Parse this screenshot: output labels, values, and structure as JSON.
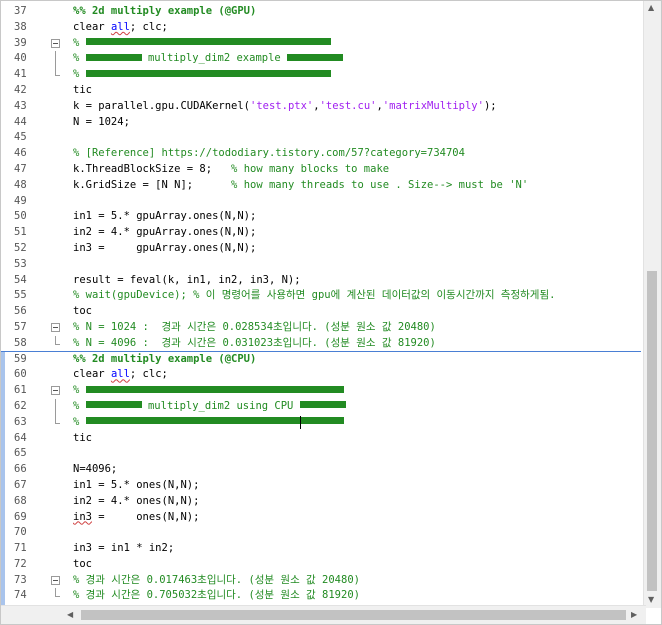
{
  "editor": {
    "lines": [
      {
        "n": "37",
        "parts": [
          {
            "t": "%% 2d multiply example (@GPU)",
            "c": "bold"
          }
        ]
      },
      {
        "n": "38",
        "parts": [
          {
            "t": "clear ",
            "c": ""
          },
          {
            "t": "all",
            "c": "kw squig"
          },
          {
            "t": "; clc;",
            "c": ""
          }
        ]
      },
      {
        "n": "39",
        "fold": "box",
        "parts": [
          {
            "t": "% ",
            "c": "cmt"
          },
          {
            "bar": 245
          }
        ]
      },
      {
        "n": "40",
        "fold": "vline",
        "parts": [
          {
            "t": "% ",
            "c": "cmt"
          },
          {
            "bar": 56
          },
          {
            "t": " multiply_dim2 example ",
            "c": "cmt"
          },
          {
            "bar": 56
          }
        ]
      },
      {
        "n": "41",
        "fold": "end",
        "parts": [
          {
            "t": "% ",
            "c": "cmt"
          },
          {
            "bar": 245
          }
        ]
      },
      {
        "n": "42",
        "parts": [
          {
            "t": "tic",
            "c": ""
          }
        ]
      },
      {
        "n": "43",
        "parts": [
          {
            "t": "k = parallel.gpu.CUDAKernel(",
            "c": ""
          },
          {
            "t": "'test.ptx'",
            "c": "str"
          },
          {
            "t": ",",
            "c": ""
          },
          {
            "t": "'test.cu'",
            "c": "str"
          },
          {
            "t": ",",
            "c": ""
          },
          {
            "t": "'matrixMultiply'",
            "c": "str"
          },
          {
            "t": ");",
            "c": ""
          }
        ]
      },
      {
        "n": "44",
        "parts": [
          {
            "t": "N = 1024;",
            "c": ""
          }
        ]
      },
      {
        "n": "45",
        "parts": []
      },
      {
        "n": "46",
        "parts": [
          {
            "t": "% [Reference] https://tododiary.tistory.com/57?category=734704",
            "c": "cmt"
          }
        ]
      },
      {
        "n": "47",
        "parts": [
          {
            "t": "k.ThreadBlockSize = 8;   ",
            "c": ""
          },
          {
            "t": "% how many blocks to make",
            "c": "cmt"
          }
        ]
      },
      {
        "n": "48",
        "parts": [
          {
            "t": "k.GridSize = [N N];      ",
            "c": ""
          },
          {
            "t": "% how many threads to use . Size--> must be 'N'",
            "c": "cmt"
          }
        ]
      },
      {
        "n": "49",
        "parts": []
      },
      {
        "n": "50",
        "parts": [
          {
            "t": "in1 = 5.* gpuArray.ones(N,N);",
            "c": ""
          }
        ]
      },
      {
        "n": "51",
        "parts": [
          {
            "t": "in2 = 4.* gpuArray.ones(N,N);",
            "c": ""
          }
        ]
      },
      {
        "n": "52",
        "parts": [
          {
            "t": "in3 =     gpuArray.ones(N,N);",
            "c": ""
          }
        ]
      },
      {
        "n": "53",
        "parts": []
      },
      {
        "n": "54",
        "parts": [
          {
            "t": "result = feval(k, in1, in2, in3, N);",
            "c": ""
          }
        ]
      },
      {
        "n": "55",
        "parts": [
          {
            "t": "% wait(gpuDevice); % 이 명령어를 사용하면 gpu에 계산된 데이터값의 이동시간까지 측정하게됨.",
            "c": "cmt"
          }
        ]
      },
      {
        "n": "56",
        "parts": [
          {
            "t": "toc",
            "c": ""
          }
        ]
      },
      {
        "n": "57",
        "fold": "box",
        "parts": [
          {
            "t": "% N = 1024 :  경과 시간은 0.028534초입니다. (성분 원소 값 20480)",
            "c": "cmt"
          }
        ]
      },
      {
        "n": "58",
        "fold": "end",
        "parts": [
          {
            "t": "% N = 4096 :  경과 시간은 0.031023초입니다. (성분 원소 값 81920)",
            "c": "cmt"
          }
        ]
      },
      {
        "n": "59",
        "parts": [
          {
            "t": "%% 2d multiply example (@CPU)",
            "c": "bold"
          }
        ]
      },
      {
        "n": "60",
        "parts": [
          {
            "t": "clear ",
            "c": ""
          },
          {
            "t": "all",
            "c": "kw squig"
          },
          {
            "t": "; clc;",
            "c": ""
          }
        ]
      },
      {
        "n": "61",
        "fold": "box",
        "parts": [
          {
            "t": "% ",
            "c": "cmt"
          },
          {
            "bar": 258
          }
        ]
      },
      {
        "n": "62",
        "fold": "vline",
        "parts": [
          {
            "t": "% ",
            "c": "cmt"
          },
          {
            "bar": 56
          },
          {
            "t": " multiply_dim2 using CPU ",
            "c": "cmt"
          },
          {
            "bar": 46
          }
        ]
      },
      {
        "n": "63",
        "fold": "end",
        "parts": [
          {
            "t": "% ",
            "c": "cmt"
          },
          {
            "bar": 258
          }
        ]
      },
      {
        "n": "64",
        "parts": [
          {
            "t": "tic",
            "c": ""
          }
        ]
      },
      {
        "n": "65",
        "parts": []
      },
      {
        "n": "66",
        "parts": [
          {
            "t": "N=4096;",
            "c": ""
          }
        ]
      },
      {
        "n": "67",
        "parts": [
          {
            "t": "in1 = 5.* ones(N,N);",
            "c": ""
          }
        ]
      },
      {
        "n": "68",
        "parts": [
          {
            "t": "in2 = 4.* ones(N,N);",
            "c": ""
          }
        ]
      },
      {
        "n": "69",
        "parts": [
          {
            "t": "in3",
            "c": "squig"
          },
          {
            "t": " =     ones(N,N);",
            "c": ""
          }
        ]
      },
      {
        "n": "70",
        "parts": []
      },
      {
        "n": "71",
        "parts": [
          {
            "t": "in3 = in1 * in2;",
            "c": ""
          }
        ]
      },
      {
        "n": "72",
        "parts": [
          {
            "t": "toc",
            "c": ""
          }
        ]
      },
      {
        "n": "73",
        "fold": "box",
        "parts": [
          {
            "t": "% 경과 시간은 0.017463초입니다. (성분 원소 값 20480)",
            "c": "cmt"
          }
        ]
      },
      {
        "n": "74",
        "fold": "end",
        "parts": [
          {
            "t": "% 경과 시간은 0.705032초입니다. (성분 원소 값 81920)",
            "c": "cmt"
          }
        ]
      }
    ]
  },
  "colors": {
    "comment": "#228b22",
    "string": "#a020f0",
    "keyword": "#0000ff",
    "cell_separator": "#4a7fd4"
  },
  "icons": {
    "scroll_up": "triangle-up-icon",
    "scroll_down": "triangle-down-icon",
    "scroll_left": "triangle-left-icon",
    "scroll_right": "triangle-right-icon",
    "fold": "fold-minus-icon"
  }
}
